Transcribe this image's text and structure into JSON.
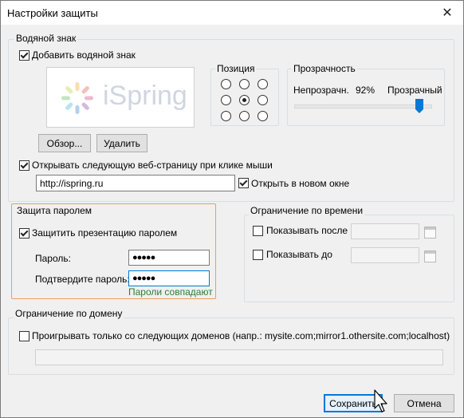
{
  "window": {
    "title": "Настройки защиты",
    "close_glyph": "✕"
  },
  "watermark": {
    "group_label": "Водяной знак",
    "add_watermark_label": "Добавить водяной знак",
    "add_watermark_checked": true,
    "preview_logo_text": "iSpring",
    "browse_label": "Обзор...",
    "remove_label": "Удалить",
    "position_label": "Позиция",
    "transparency_label": "Прозрачность",
    "opaque_label": "Непрозрачн.",
    "transparent_label": "Прозрачный",
    "transparency_value": "92%",
    "transparency_fraction": 0.92,
    "open_url_label": "Открывать следующую веб-страницу при клике мыши",
    "open_url_checked": true,
    "url_value": "http://ispring.ru",
    "new_window_label": "Открыть в новом окне",
    "new_window_checked": true
  },
  "password": {
    "group_label": "Защита паролем",
    "protect_label": "Защитить презентацию паролем",
    "protect_checked": true,
    "password_label": "Пароль:",
    "password_value": "●●●●●",
    "confirm_label": "Подтвердите пароль:",
    "confirm_value": "●●●●●",
    "match_text": "Пароли совпадают",
    "match_color": "#2e7d32",
    "accent_border": "#e8a05c"
  },
  "time": {
    "group_label": "Ограничение по времени",
    "show_after_label": "Показывать после",
    "show_until_label": "Показывать до"
  },
  "domain": {
    "group_label": "Ограничение по домену",
    "play_only_label": "Проигрывать только со следующих доменов (напр.: mysite.com;mirror1.othersite.com;localhost)"
  },
  "footer": {
    "save_label": "Сохранить",
    "cancel_label": "Отмена"
  }
}
